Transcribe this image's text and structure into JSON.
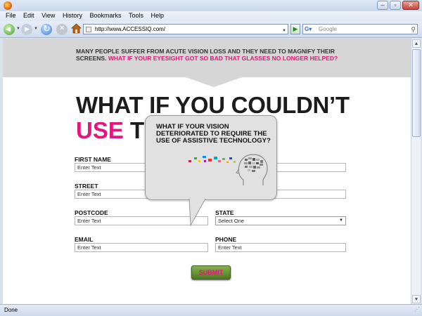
{
  "menu": {
    "items": [
      "File",
      "Edit",
      "View",
      "History",
      "Bookmarks",
      "Tools",
      "Help"
    ]
  },
  "nav": {
    "url": "http://www.ACCESSIQ.com/",
    "search_placeholder": "Google"
  },
  "banner": {
    "text": "MANY PEOPLE SUFFER FROM ACUTE VISION LOSS AND THEY NEED TO MAGNIFY THEIR SCREENS.",
    "highlight": "WHAT IF YOUR EYESIGHT GOT SO BAD THAT GLASSES NO LONGER HELPED?"
  },
  "headline": {
    "line1": "WHAT IF YOU COULDN’T",
    "line2_pink": "USE",
    "line2_dark": "TH"
  },
  "form": {
    "first_name_label": "FIRST NAME",
    "first_name_value": "Enter Text",
    "street_label": "STREET",
    "street_value": "Enter Text",
    "postcode_label": "POSTCODE",
    "postcode_value": "Enter Text",
    "state_label": "STATE",
    "state_value": "Select One",
    "email_label": "EMAIL",
    "email_value": "Enter Text",
    "phone_label": "PHONE",
    "phone_value": "Enter Text",
    "submit_label": "SUBMIT"
  },
  "bubble": {
    "text": "WHAT IF YOUR VISION DETERIORATED TO REQUIRE THE USE OF ASSISTIVE TECHNOLOGY?"
  },
  "status": {
    "text": "Done"
  },
  "colors": {
    "accent_pink": "#e0177c",
    "submit_green": "#5f8f2e"
  }
}
